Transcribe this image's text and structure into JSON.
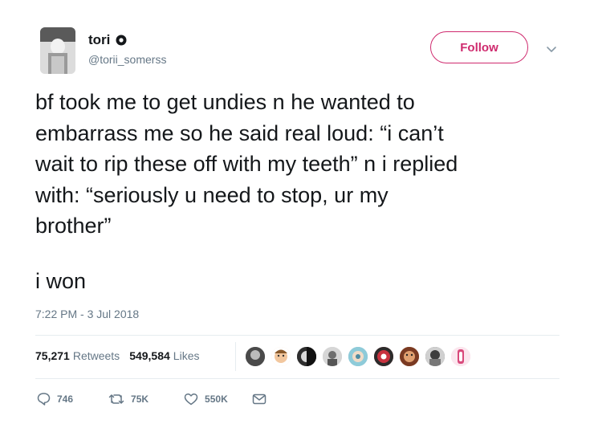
{
  "user": {
    "name": "tori",
    "handle": "@torii_somerss"
  },
  "follow_label": "Follow",
  "tweet": {
    "text": "bf took me to get undies n he wanted to\nembarrass me so he said real loud: “i can’t\nwait to rip these off with my teeth” n i replied\nwith: “seriously u need to stop, ur my\nbrother”",
    "coda": "i won",
    "timestamp": "7:22 PM - 3 Jul 2018"
  },
  "stats": {
    "retweets_count": "75,271",
    "retweets_label": "Retweets",
    "likes_count": "549,584",
    "likes_label": "Likes"
  },
  "actions": {
    "reply_count": "746",
    "retweet_count": "75K",
    "like_count": "550K"
  },
  "colors": {
    "accent": "#cf2a6e",
    "muted": "#657786",
    "text": "#14171a"
  }
}
